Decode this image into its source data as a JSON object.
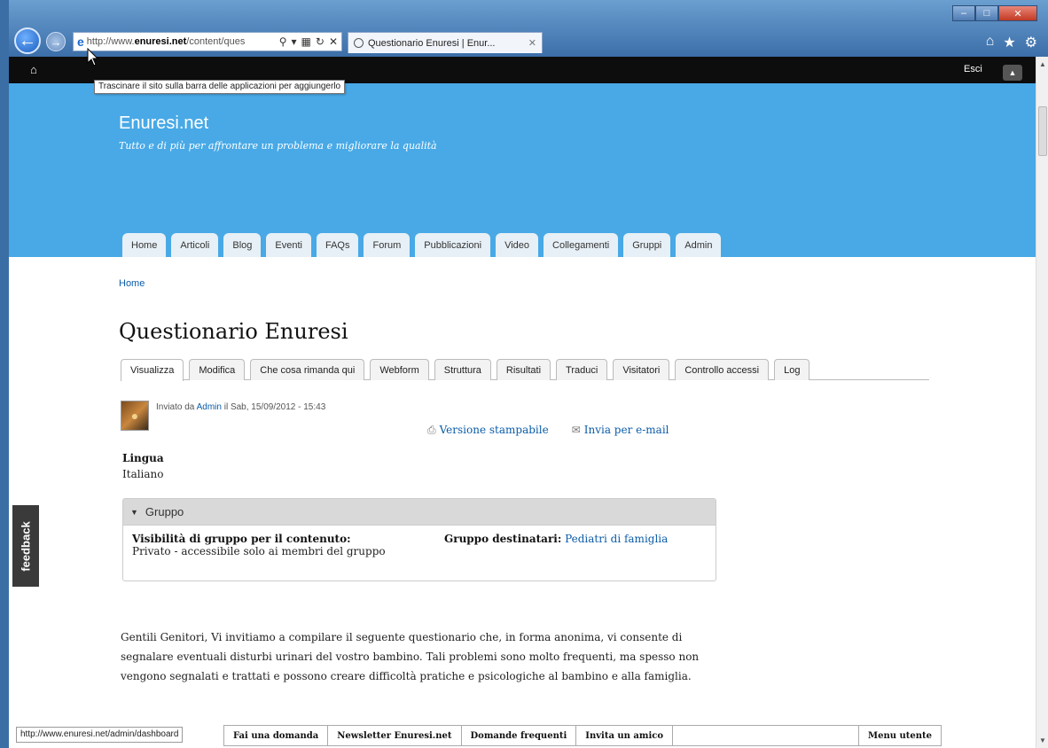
{
  "browser": {
    "address_prefix": "http://www.",
    "address_host": "enuresi.net",
    "address_rest": "/content/ques",
    "tab_title": "Questionario Enuresi | Enur...",
    "tooltip": "Trascinare il sito sulla barra delle applicazioni per aggiungerlo",
    "status_url": "http://www.enuresi.net/admin/dashboard"
  },
  "adminbar": {
    "logout_label": "Esci"
  },
  "site": {
    "name": "Enuresi.net",
    "slogan": "Tutto e di più per affrontare un problema e migliorare la qualità"
  },
  "primary_tabs": [
    "Home",
    "Articoli",
    "Blog",
    "Eventi",
    "FAQs",
    "Forum",
    "Pubblicazioni",
    "Video",
    "Collegamenti",
    "Gruppi",
    "Admin"
  ],
  "breadcrumb": "Home",
  "page_title": "Questionario Enuresi",
  "local_tabs": [
    "Visualizza",
    "Modifica",
    "Che cosa rimanda qui",
    "Webform",
    "Struttura",
    "Risultati",
    "Traduci",
    "Visitatori",
    "Controllo accessi",
    "Log"
  ],
  "node": {
    "submitted_prefix": "Inviato da ",
    "author": "Admin",
    "submitted_suffix": " il Sab, 15/09/2012 - 15:43",
    "print_label": "Versione stampabile",
    "email_label": "Invia per e-mail",
    "language_label": "Lingua",
    "language_value": "Italiano"
  },
  "group": {
    "legend": "Gruppo",
    "visibility_label": "Visibilità di gruppo per il contenuto:",
    "visibility_value": "Privato - accessibile solo ai membri del gruppo",
    "audience_label": "Gruppo destinatari:",
    "audience_value": "Pediatri di famiglia"
  },
  "body_text": "Gentili Genitori, Vi invitiamo a compilare il seguente questionario che, in forma anonima, vi consente di segnalare eventuali disturbi urinari del vostro bambino. Tali problemi sono molto frequenti, ma spesso non vengono segnalati e trattati e possono creare difficoltà pratiche e psicologiche al bambino e alla famiglia.",
  "feedback_label": "feedback",
  "bottom_bar": [
    "Fai una domanda",
    "Newsletter Enuresi.net",
    "Domande frequenti",
    "Invita un amico",
    "Menu utente"
  ],
  "colors": {
    "header_bg": "#48a9e6",
    "link": "#0a5ca8",
    "admin_bar": "#0d0d0d"
  }
}
